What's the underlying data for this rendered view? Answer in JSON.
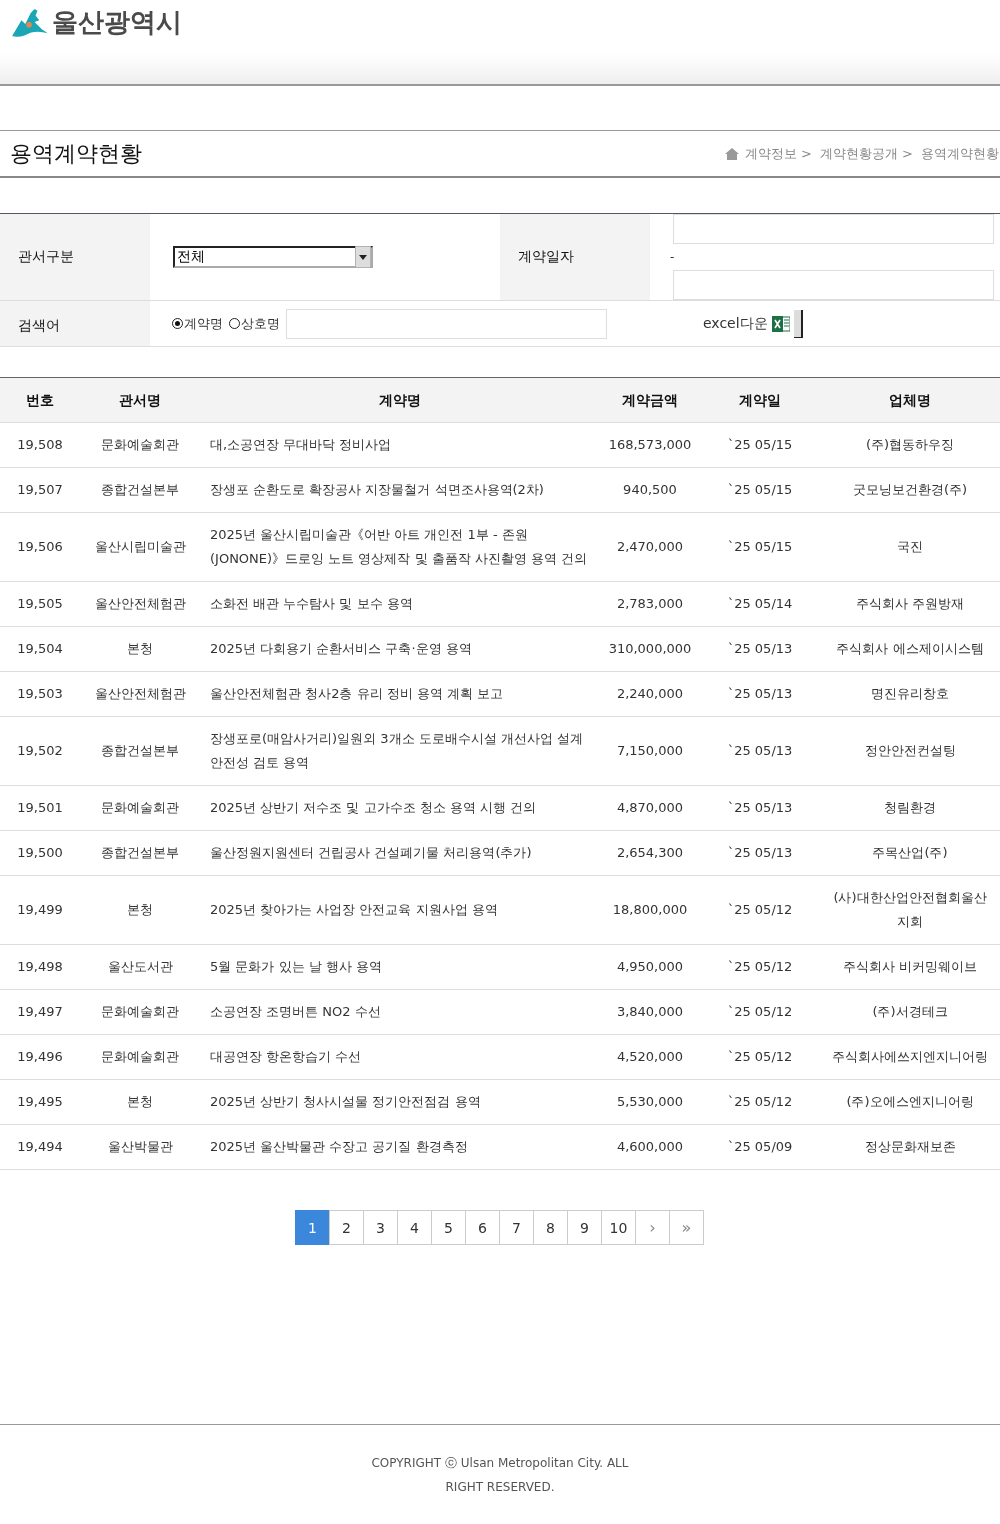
{
  "site": {
    "name": "울산광역시"
  },
  "page": {
    "title": "용역계약현황",
    "breadcrumb": [
      "계약정보 >",
      "계약현황공개 >",
      "용역계약현황"
    ]
  },
  "search": {
    "dept_label": "관서구분",
    "dept_value": "전체",
    "date_label": "계약일자",
    "date_separator": "-",
    "keyword_label": "검색어",
    "radios": [
      {
        "label": "계약명",
        "selected": true
      },
      {
        "label": "상호명",
        "selected": false
      }
    ],
    "excel_label": "excel다운"
  },
  "table": {
    "columns": [
      "번호",
      "관서명",
      "계약명",
      "계약금액",
      "계약일",
      "업체명"
    ],
    "rows": [
      [
        "19,508",
        "문화예술회관",
        "대,소공연장 무대바닥 정비사업",
        "168,573,000",
        "`25 05/15",
        "(주)협동하우징"
      ],
      [
        "19,507",
        "종합건설본부",
        "장생포 순환도로 확장공사 지장물철거 석면조사용역(2차)",
        "940,500",
        "`25 05/15",
        "굿모닝보건환경(주)"
      ],
      [
        "19,506",
        "울산시립미술관",
        "2025년 울산시립미술관《어반 아트 개인전 1부 - 존원(JONONE)》드로잉 노트 영상제작 및 출품작 사진촬영 용역 건의",
        "2,470,000",
        "`25 05/15",
        "국진"
      ],
      [
        "19,505",
        "울산안전체험관",
        "소화전 배관 누수탐사 및 보수 용역",
        "2,783,000",
        "`25 05/14",
        "주식회사 주원방재"
      ],
      [
        "19,504",
        "본청",
        "2025년 다회용기 순환서비스 구축·운영 용역",
        "310,000,000",
        "`25 05/13",
        "주식회사 에스제이시스템"
      ],
      [
        "19,503",
        "울산안전체험관",
        "울산안전체험관 청사2층 유리 정비 용역 계획 보고",
        "2,240,000",
        "`25 05/13",
        "명진유리창호"
      ],
      [
        "19,502",
        "종합건설본부",
        "장생포로(매암사거리)일원외 3개소 도로배수시설 개선사업 설계안전성 검토 용역",
        "7,150,000",
        "`25 05/13",
        "정안안전컨설팅"
      ],
      [
        "19,501",
        "문화예술회관",
        "2025년 상반기 저수조 및 고가수조 청소 용역 시행 건의",
        "4,870,000",
        "`25 05/13",
        "청림환경"
      ],
      [
        "19,500",
        "종합건설본부",
        "울산정원지원센터 건립공사 건설폐기물 처리용역(추가)",
        "2,654,300",
        "`25 05/13",
        "주목산업(주)"
      ],
      [
        "19,499",
        "본청",
        "2025년 찾아가는 사업장 안전교육 지원사업 용역",
        "18,800,000",
        "`25 05/12",
        "(사)대한산업안전협회울산지회"
      ],
      [
        "19,498",
        "울산도서관",
        "5월 문화가 있는 날 행사 용역",
        "4,950,000",
        "`25 05/12",
        "주식회사 비커밍웨이브"
      ],
      [
        "19,497",
        "문화예술회관",
        "소공연장 조명버튼 NO2 수선",
        "3,840,000",
        "`25 05/12",
        "(주)서경테크"
      ],
      [
        "19,496",
        "문화예술회관",
        "대공연장 항온항습기 수선",
        "4,520,000",
        "`25 05/12",
        "주식회사에쓰지엔지니어링"
      ],
      [
        "19,495",
        "본청",
        "2025년 상반기 청사시설물 정기안전점검 용역",
        "5,530,000",
        "`25 05/12",
        "(주)오에스엔지니어링"
      ],
      [
        "19,494",
        "울산박물관",
        "2025년 울산박물관 수장고 공기질 환경측정",
        "4,600,000",
        "`25 05/09",
        "정상문화재보존"
      ]
    ]
  },
  "pagination": {
    "pages": [
      {
        "label": "1",
        "selected": true
      },
      {
        "label": "2",
        "selected": false
      },
      {
        "label": "3",
        "selected": false
      },
      {
        "label": "4",
        "selected": false
      },
      {
        "label": "5",
        "selected": false
      },
      {
        "label": "6",
        "selected": false
      },
      {
        "label": "7",
        "selected": false
      },
      {
        "label": "8",
        "selected": false
      },
      {
        "label": "9",
        "selected": false
      },
      {
        "label": "10",
        "selected": false
      }
    ],
    "next": "›",
    "last": "»"
  },
  "footer": {
    "copyright": "COPYRIGHT ⓒ Ulsan Metropolitan City. ALL RIGHT RESERVED."
  }
}
